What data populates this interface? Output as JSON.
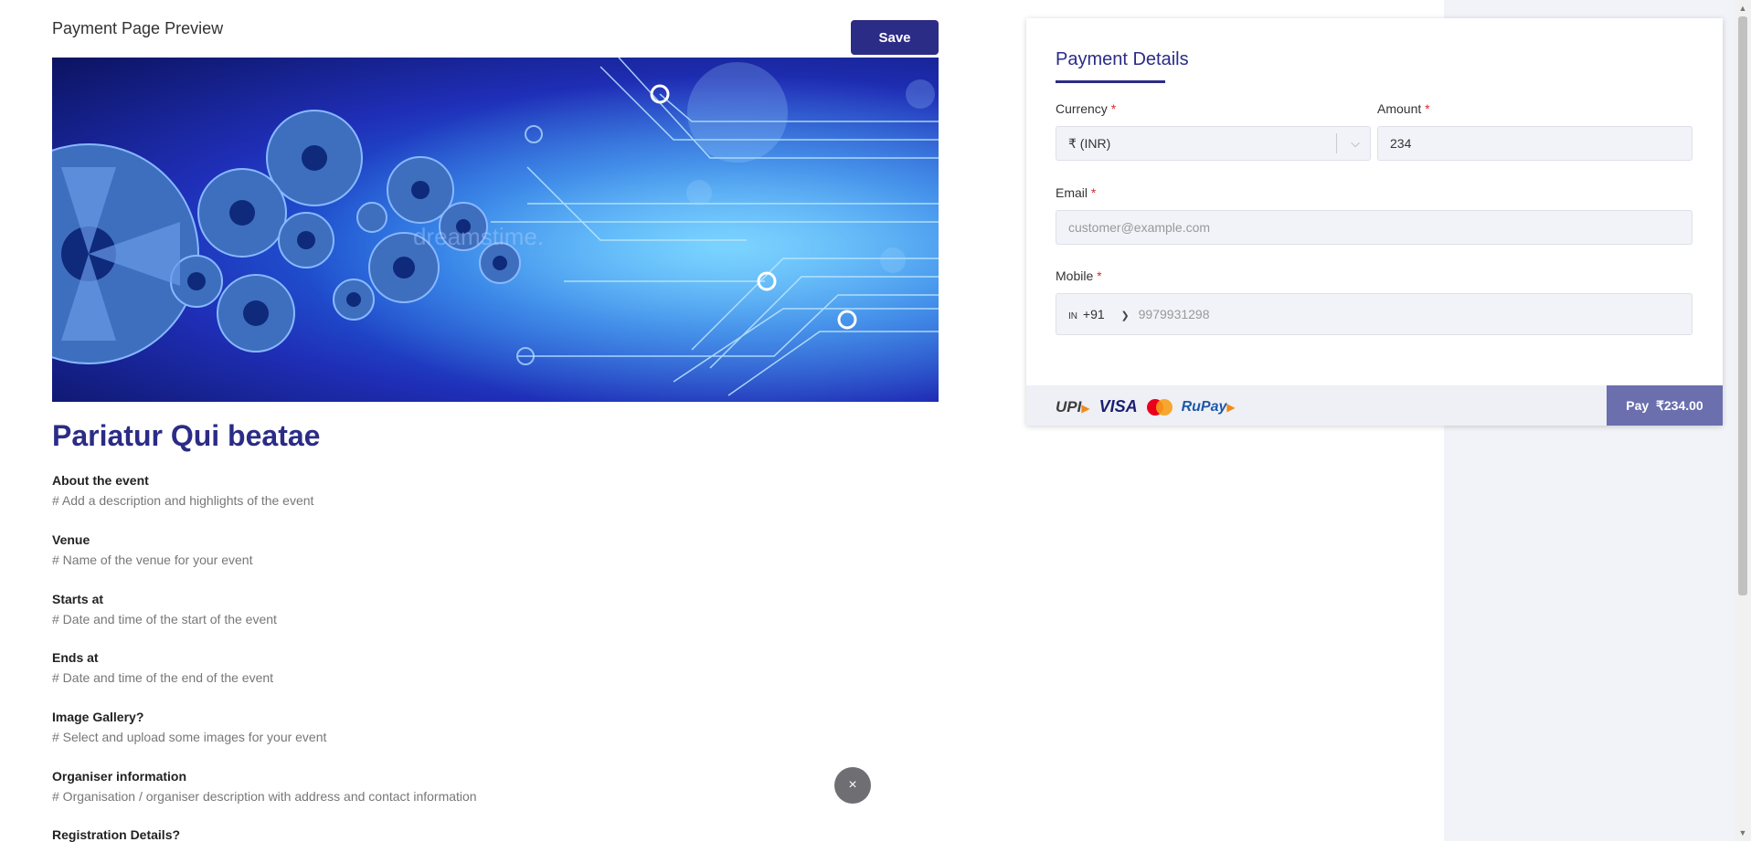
{
  "preview": {
    "title": "Payment Page Preview",
    "save_label": "Save"
  },
  "banner": {
    "watermark": "dreamstime."
  },
  "event": {
    "title": "Pariatur Qui beatae",
    "sections": [
      {
        "label": "About the event",
        "desc": "# Add a description and highlights of the event"
      },
      {
        "label": "Venue",
        "desc": "# Name of the venue for your event"
      },
      {
        "label": "Starts at",
        "desc": "# Date and time of the start of the event"
      },
      {
        "label": "Ends at",
        "desc": "# Date and time of the end of the event"
      },
      {
        "label": "Image Gallery?",
        "desc": "# Select and upload some images for your event"
      },
      {
        "label": "Organiser information",
        "desc": "# Organisation / organiser  description with address and contact information"
      },
      {
        "label": "Registration Details?",
        "desc": ""
      }
    ]
  },
  "close_icon": "×",
  "payment": {
    "title": "Payment Details",
    "currency": {
      "label": "Currency",
      "required": "*",
      "value": "₹ (INR)"
    },
    "amount": {
      "label": "Amount",
      "required": "*",
      "value": "234"
    },
    "email": {
      "label": "Email",
      "required": "*",
      "placeholder": "customer@example.com"
    },
    "mobile": {
      "label": "Mobile",
      "required": "*",
      "flag": "IN",
      "code": "+91",
      "placeholder": "9979931298"
    },
    "logos": {
      "upi": "UPI",
      "visa": "VISA",
      "rupay": "RuPay"
    },
    "pay_label": "Pay",
    "pay_amount": "₹234.00"
  },
  "colors": {
    "brand": "#2b2c86",
    "pay_button": "#6b6fae",
    "required": "#d92b2b"
  }
}
